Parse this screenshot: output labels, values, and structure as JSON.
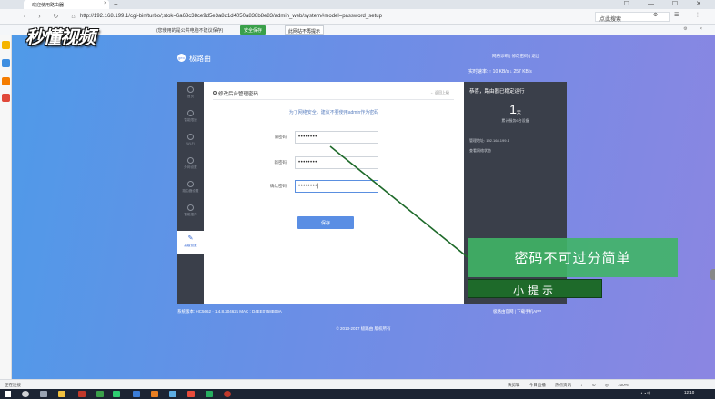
{
  "browser": {
    "tab_title": "欢迎使用路由器",
    "tab_close": "×",
    "new_tab": "+",
    "window_controls": "☐ — ☐ ✕",
    "nav": "‹ › ↻ ⌂",
    "url": "http://192.168.199.1/cgi-bin/turbo/;stok=6a63c38ce9d5e3a8d1d4050a838b8e83/admin_web/system#model=password_setup",
    "search_placeholder": "点此搜索",
    "tools": "⚙ ☰ ⋮",
    "infobar_message": "(您使用的是公共电脑不建议保存)",
    "infobar_save": "安全保存",
    "infobar_nomore": "此网站不再提示",
    "infobar_icons": "⚙ ×"
  },
  "watermark": "秒懂视频",
  "router": {
    "brand_icon_text": "geo",
    "brand": "极路由",
    "top_links": "网络诊断  |  修改密码  |  退出",
    "speed": "实时速率:   ↑ 10 KB/s   ↓ 257 KB/s",
    "nav_items": [
      {
        "label": "首页",
        "icon": "home-icon"
      },
      {
        "label": "智能限速",
        "icon": "speed-icon"
      },
      {
        "label": "Wi-Fi",
        "icon": "wifi-icon"
      },
      {
        "label": "外网设置",
        "icon": "globe-icon"
      },
      {
        "label": "路由器设置",
        "icon": "router-icon"
      },
      {
        "label": "智能插件",
        "icon": "plugin-icon"
      },
      {
        "label": "高级设置",
        "icon": "wrench-icon"
      }
    ],
    "panel_title": "修改后台管理密码",
    "back_link": "← 返回上级",
    "hint": "为了网络安全，建议不要使用admin作为密码",
    "fields": {
      "old_label": "旧密码",
      "old_value": "••••••••",
      "new_label": "新密码",
      "new_value": "••••••••",
      "confirm_label": "确认密码",
      "confirm_value": "••••••••|"
    },
    "save_label": "保存",
    "status_title": "恭喜，路由器已稳定运行",
    "uptime_value": "1",
    "uptime_unit": "天",
    "uptime_sub": "累计服务6台设备",
    "info_ip": "管理地址: 192.168.199.1",
    "info_backup": "查看网络状态",
    "footer_left": "系统版本: HC5662 · 1.4.8.20462s    MAC : D4EE0758B09A",
    "footer_right": "极路由官网   |   下载手机APP",
    "copyright": "© 2013-2017 极路由 版权所有"
  },
  "overlay": {
    "tip_main": "密码不可过分简单",
    "tip_sub": "小提示",
    "main_color": "#40b566",
    "sub_color": "#1e6a2a"
  },
  "statusbar": {
    "left": "正在连接",
    "items": [
      "快剪辑",
      "今日直播",
      "热点资讯",
      "↓",
      "⊙",
      "◎",
      "100%"
    ]
  },
  "taskbar": {
    "tray": "∧ ◂ 中",
    "clock": "12:10"
  }
}
